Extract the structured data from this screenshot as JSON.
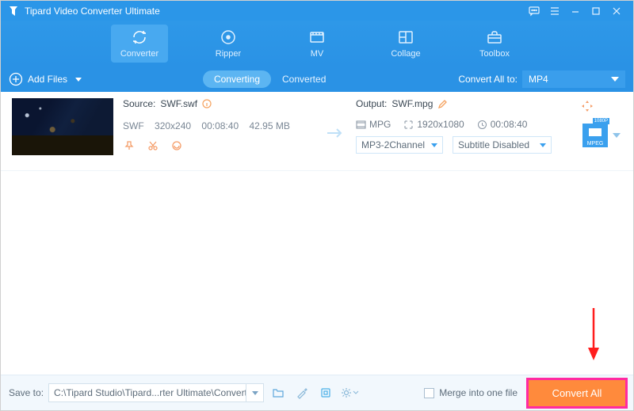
{
  "titlebar": {
    "title": "Tipard Video Converter Ultimate"
  },
  "nav": {
    "converter": "Converter",
    "ripper": "Ripper",
    "mv": "MV",
    "collage": "Collage",
    "toolbox": "Toolbox"
  },
  "secondbar": {
    "add_files": "Add Files",
    "tab_converting": "Converting",
    "tab_converted": "Converted",
    "convert_all_to": "Convert All to:",
    "format": "MP4"
  },
  "file": {
    "source_label": "Source:",
    "source_name": "SWF.swf",
    "src_format": "SWF",
    "src_res": "320x240",
    "src_dur": "00:08:40",
    "src_size": "42.95 MB",
    "output_label": "Output:",
    "output_name": "SWF.mpg",
    "out_container": "MPG",
    "out_res": "1920x1080",
    "out_dur": "00:08:40",
    "audio_select": "MP3-2Channel",
    "subtitle_select": "Subtitle Disabled",
    "badge_top": "1080P",
    "badge_text": "MPEG"
  },
  "bottom": {
    "save_to": "Save to:",
    "path": "C:\\Tipard Studio\\Tipard...rter Ultimate\\Converted",
    "merge": "Merge into one file",
    "convert_all": "Convert All"
  }
}
